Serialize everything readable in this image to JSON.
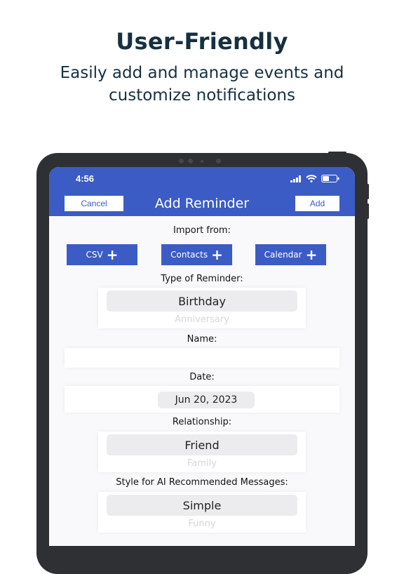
{
  "marketing": {
    "headline": "User-Friendly",
    "subheadline_line1": "Easily add and manage events and",
    "subheadline_line2": "customize notifications"
  },
  "status_bar": {
    "time": "4:56",
    "icons": [
      "cellular-signal-icon",
      "wifi-icon",
      "battery-icon"
    ]
  },
  "nav": {
    "cancel_label": "Cancel",
    "title": "Add Reminder",
    "add_label": "Add"
  },
  "form": {
    "import_label": "Import from:",
    "import_buttons": [
      {
        "label": "CSV",
        "icon": "plus-icon"
      },
      {
        "label": "Contacts",
        "icon": "plus-icon"
      },
      {
        "label": "Calendar",
        "icon": "plus-icon"
      }
    ],
    "type_label": "Type of Reminder:",
    "type_picker": {
      "selected": "Birthday",
      "next": "Anniversary"
    },
    "name_label": "Name:",
    "name_value": "",
    "date_label": "Date:",
    "date_value": "Jun 20, 2023",
    "relationship_label": "Relationship:",
    "relationship_picker": {
      "selected": "Friend",
      "next": "Family"
    },
    "style_label": "Style for AI Recommended Messages:",
    "style_picker": {
      "selected": "Simple",
      "next": "Funny"
    }
  },
  "colors": {
    "accent": "#3b5cc5",
    "headline_text": "#163040",
    "device_frame": "#2e3033",
    "screen_bg": "#f9f9fb"
  }
}
